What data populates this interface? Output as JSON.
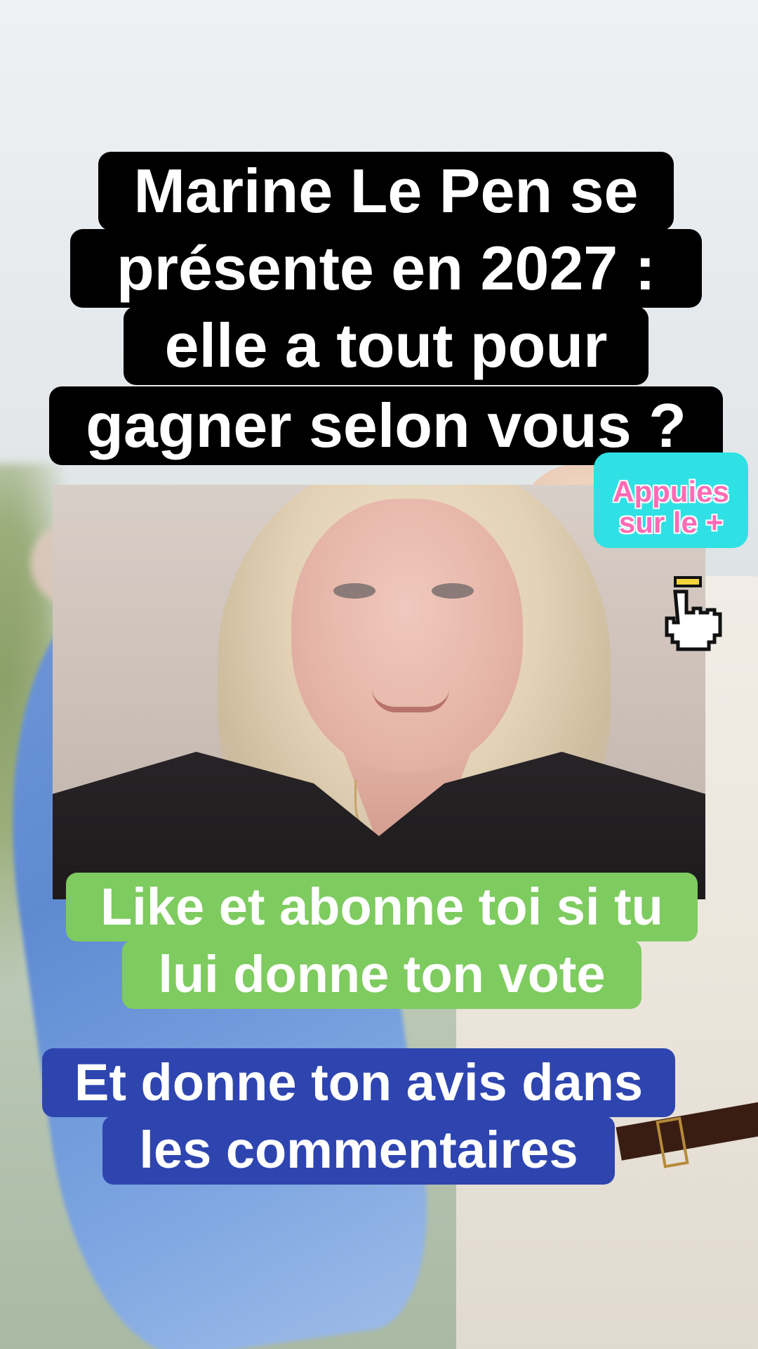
{
  "title_caption": {
    "lines": [
      "Marine Le Pen se",
      "présente en 2027 :",
      "elle a tout pour",
      "gagner selon vous ?"
    ]
  },
  "green_caption": {
    "lines": [
      "Like et abonne toi si tu",
      "lui donne ton vote"
    ]
  },
  "blue_caption": {
    "lines": [
      "Et donne ton avis dans",
      "les commentaires"
    ]
  },
  "sticker": {
    "lines": [
      "Appuies",
      "sur le +"
    ]
  },
  "icons": {
    "pointer": "pointing-hand-icon"
  },
  "colors": {
    "title_bg": "#000000",
    "green_bg": "#7ecb5f",
    "blue_bg": "#2e45b0",
    "sticker_bg": "#2fe1e4",
    "sticker_text": "#ff6bb5"
  }
}
